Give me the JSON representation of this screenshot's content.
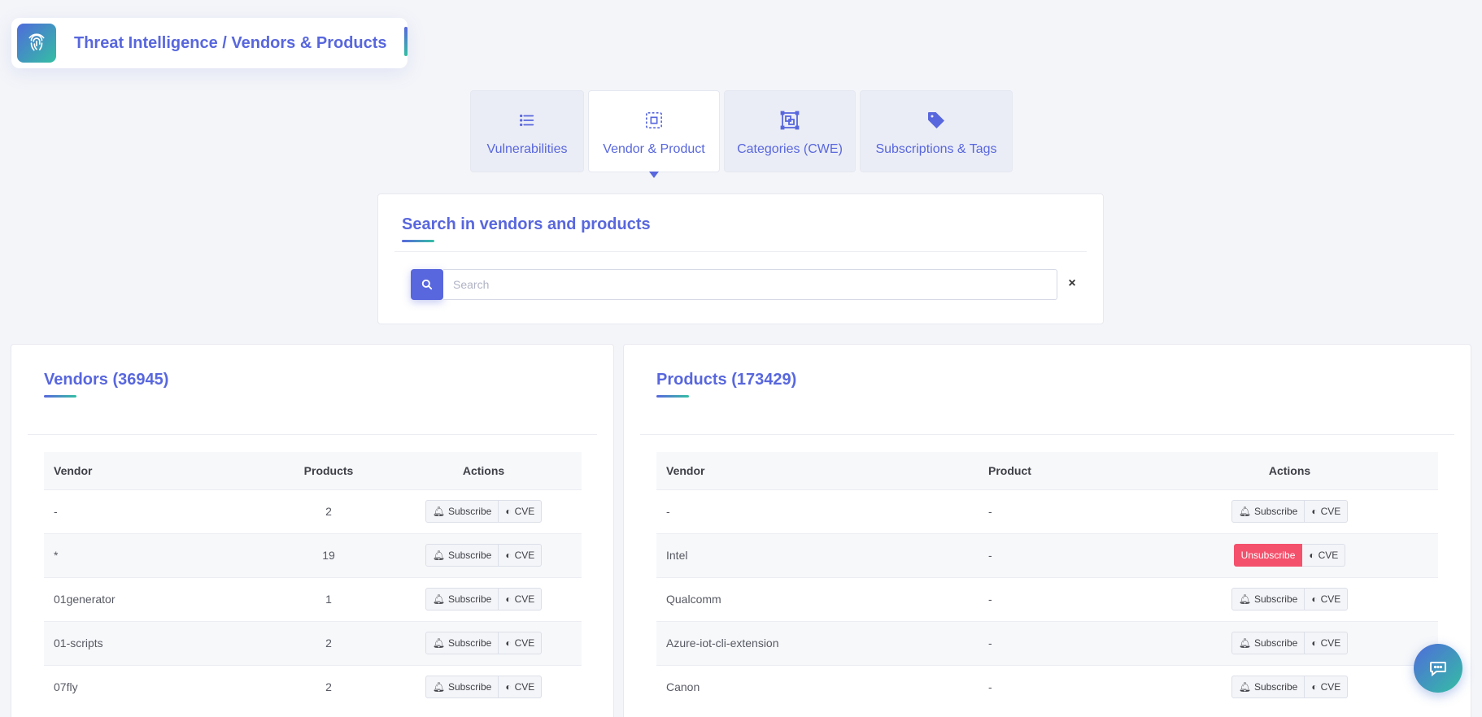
{
  "header": {
    "title": "Threat Intelligence / Vendors & Products",
    "logo_icon": "fingerprint-icon"
  },
  "tabs": [
    {
      "label": "Vulnerabilities",
      "icon": "list-icon",
      "active": false
    },
    {
      "label": "Vendor & Product",
      "icon": "select-box-icon",
      "active": true
    },
    {
      "label": "Categories (CWE)",
      "icon": "layers-frame-icon",
      "active": false
    },
    {
      "label": "Subscriptions & Tags",
      "icon": "tag-icon",
      "active": false
    }
  ],
  "search": {
    "title": "Search in vendors and products",
    "placeholder": "Search",
    "value": "",
    "clear_label": "×"
  },
  "vendors": {
    "title": "Vendors (36945)",
    "columns": [
      "Vendor",
      "Products",
      "Actions"
    ],
    "rows": [
      {
        "vendor": "-",
        "products": "2",
        "action_primary": "Subscribe",
        "action_secondary": "CVE"
      },
      {
        "vendor": "*",
        "products": "19",
        "action_primary": "Subscribe",
        "action_secondary": "CVE"
      },
      {
        "vendor": "01generator",
        "products": "1",
        "action_primary": "Subscribe",
        "action_secondary": "CVE"
      },
      {
        "vendor": "01-scripts",
        "products": "2",
        "action_primary": "Subscribe",
        "action_secondary": "CVE"
      },
      {
        "vendor": "07fly",
        "products": "2",
        "action_primary": "Subscribe",
        "action_secondary": "CVE"
      }
    ]
  },
  "products": {
    "title": "Products (173429)",
    "columns": [
      "Vendor",
      "Product",
      "Actions"
    ],
    "rows": [
      {
        "vendor": "-",
        "product": "-",
        "action_primary": "Subscribe",
        "action_secondary": "CVE",
        "subscribed": false
      },
      {
        "vendor": "Intel",
        "product": "-",
        "action_primary": "Unsubscribe",
        "action_secondary": "CVE",
        "subscribed": true
      },
      {
        "vendor": "Qualcomm",
        "product": "-",
        "action_primary": "Subscribe",
        "action_secondary": "CVE",
        "subscribed": false
      },
      {
        "vendor": "Azure-iot-cli-extension",
        "product": "-",
        "action_primary": "Subscribe",
        "action_secondary": "CVE",
        "subscribed": false
      },
      {
        "vendor": "Canon",
        "product": "-",
        "action_primary": "Subscribe",
        "action_secondary": "CVE",
        "subscribed": false
      }
    ]
  },
  "colors": {
    "primary": "#5867dd",
    "accent": "#34bfa3",
    "danger": "#f4516c",
    "background": "#f4f5f9"
  },
  "chat": {
    "icon": "chat-bubble-icon"
  }
}
